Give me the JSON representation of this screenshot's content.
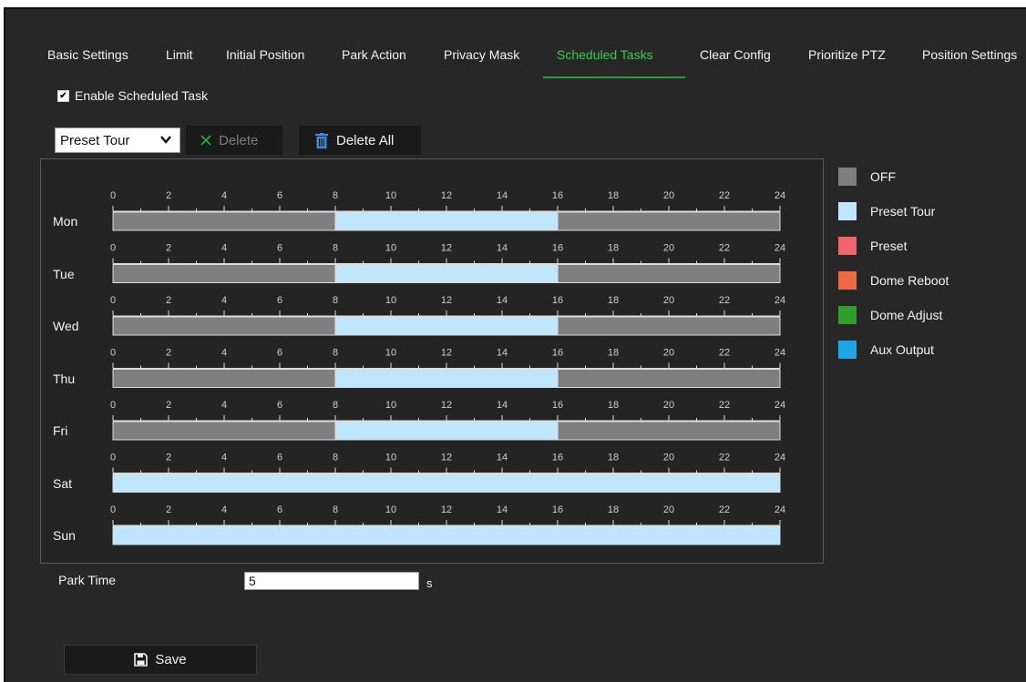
{
  "tabs": [
    {
      "label": "Basic Settings"
    },
    {
      "label": "Limit"
    },
    {
      "label": "Initial Position"
    },
    {
      "label": "Park Action"
    },
    {
      "label": "Privacy Mask"
    },
    {
      "label": "Scheduled Tasks",
      "active": true
    },
    {
      "label": "Clear Config"
    },
    {
      "label": "Prioritize PTZ"
    },
    {
      "label": "Position Settings"
    }
  ],
  "enable_task": {
    "label": "Enable Scheduled Task",
    "checked": true
  },
  "task_select": {
    "value": "Preset Tour"
  },
  "toolbar": {
    "delete_label": "Delete",
    "delete_all_label": "Delete All"
  },
  "schedule": {
    "hour_ticks": [
      "0",
      "2",
      "4",
      "6",
      "8",
      "10",
      "12",
      "14",
      "16",
      "18",
      "20",
      "22",
      "24"
    ],
    "days": [
      {
        "label": "Mon",
        "segments": [
          {
            "start": 0,
            "end": 8,
            "type": "OFF"
          },
          {
            "start": 8,
            "end": 16,
            "type": "Preset Tour"
          },
          {
            "start": 16,
            "end": 24,
            "type": "OFF"
          }
        ]
      },
      {
        "label": "Tue",
        "segments": [
          {
            "start": 0,
            "end": 8,
            "type": "OFF"
          },
          {
            "start": 8,
            "end": 16,
            "type": "Preset Tour"
          },
          {
            "start": 16,
            "end": 24,
            "type": "OFF"
          }
        ]
      },
      {
        "label": "Wed",
        "segments": [
          {
            "start": 0,
            "end": 8,
            "type": "OFF"
          },
          {
            "start": 8,
            "end": 16,
            "type": "Preset Tour"
          },
          {
            "start": 16,
            "end": 24,
            "type": "OFF"
          }
        ]
      },
      {
        "label": "Thu",
        "segments": [
          {
            "start": 0,
            "end": 8,
            "type": "OFF"
          },
          {
            "start": 8,
            "end": 16,
            "type": "Preset Tour"
          },
          {
            "start": 16,
            "end": 24,
            "type": "OFF"
          }
        ]
      },
      {
        "label": "Fri",
        "segments": [
          {
            "start": 0,
            "end": 8,
            "type": "OFF"
          },
          {
            "start": 8,
            "end": 16,
            "type": "Preset Tour"
          },
          {
            "start": 16,
            "end": 24,
            "type": "OFF"
          }
        ]
      },
      {
        "label": "Sat",
        "segments": [
          {
            "start": 0,
            "end": 24,
            "type": "Preset Tour"
          }
        ]
      },
      {
        "label": "Sun",
        "segments": [
          {
            "start": 0,
            "end": 24,
            "type": "Preset Tour"
          }
        ]
      }
    ]
  },
  "legend": [
    {
      "label": "OFF",
      "color": "#7f7f7f"
    },
    {
      "label": "Preset Tour",
      "color": "#bfe6fb"
    },
    {
      "label": "Preset",
      "color": "#f0646e"
    },
    {
      "label": "Dome Reboot",
      "color": "#ee6a45"
    },
    {
      "label": "Dome Adjust",
      "color": "#2f9e2a"
    },
    {
      "label": "Aux Output",
      "color": "#1ea6e6"
    }
  ],
  "park_time": {
    "label": "Park Time",
    "value": "5",
    "unit": "s"
  },
  "save_label": "Save",
  "colors": {
    "accent": "#3cc94f",
    "off": "#7f7f7f",
    "preset_tour": "#bfe6fb"
  }
}
